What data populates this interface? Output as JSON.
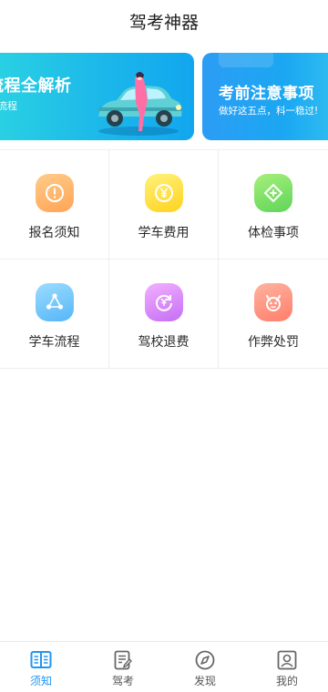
{
  "header": {
    "title": "驾考神器"
  },
  "banners": [
    {
      "title": "流程全解析",
      "subtitle": "全流程"
    },
    {
      "title": "考前注意事项",
      "subtitle": "做好这五点，科一稳过!"
    }
  ],
  "grid": [
    {
      "label": "报名须知",
      "icon": "exclamation-icon",
      "color_from": "#ffcc8a",
      "color_to": "#ffa455"
    },
    {
      "label": "学车费用",
      "icon": "yen-coin-icon",
      "color_from": "#fff27a",
      "color_to": "#ffd21f"
    },
    {
      "label": "体检事项",
      "icon": "medical-diamond-icon",
      "color_from": "#a6f07a",
      "color_to": "#5fd45a"
    },
    {
      "label": "学车流程",
      "icon": "flow-cycle-icon",
      "color_from": "#9cdcff",
      "color_to": "#55b6f7"
    },
    {
      "label": "驾校退费",
      "icon": "refund-icon",
      "color_from": "#f2b0ff",
      "color_to": "#c56ef5"
    },
    {
      "label": "作弊处罚",
      "icon": "demon-face-icon",
      "color_from": "#ffb3a0",
      "color_to": "#ff7e6a"
    }
  ],
  "tabbar": [
    {
      "label": "须知",
      "icon": "book-icon",
      "active": true
    },
    {
      "label": "驾考",
      "icon": "exam-paper-icon",
      "active": false
    },
    {
      "label": "发现",
      "icon": "compass-icon",
      "active": false
    },
    {
      "label": "我的",
      "icon": "profile-icon",
      "active": false
    }
  ],
  "colors": {
    "accent": "#2196f3",
    "inactive": "#555555"
  }
}
